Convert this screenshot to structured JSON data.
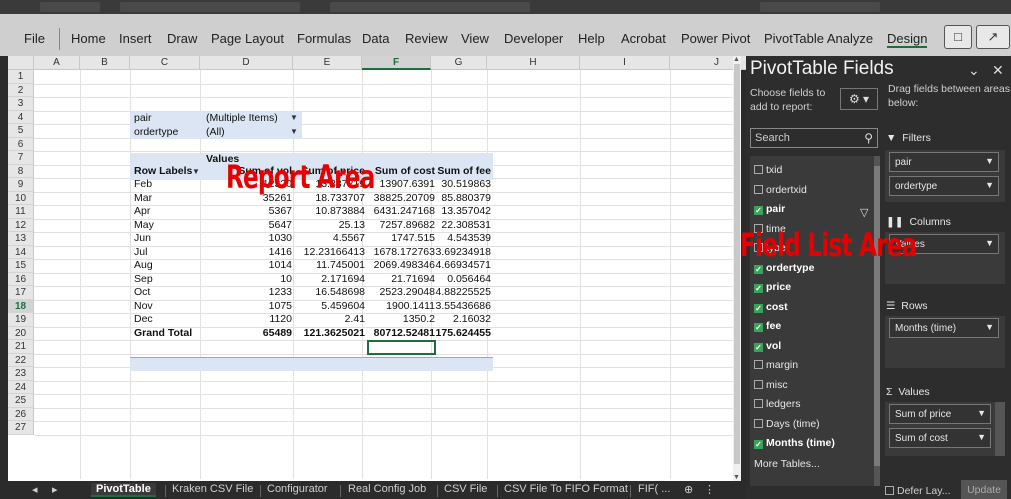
{
  "ribbon": {
    "tabs": [
      "File",
      "Home",
      "Insert",
      "Draw",
      "Page Layout",
      "Formulas",
      "Data",
      "Review",
      "View",
      "Developer",
      "Help",
      "Acrobat",
      "Power Pivot",
      "PivotTable Analyze",
      "Design"
    ],
    "comment_icon": "comment-icon",
    "share_icon": "share-icon"
  },
  "grid": {
    "columns": [
      "A",
      "B",
      "C",
      "D",
      "E",
      "F",
      "G",
      "H",
      "I",
      "J"
    ],
    "rows": [
      "1",
      "2",
      "3",
      "4",
      "5",
      "6",
      "7",
      "8",
      "9",
      "10",
      "11",
      "12",
      "13",
      "14",
      "15",
      "16",
      "17",
      "18",
      "19",
      "20",
      "21",
      "22",
      "23",
      "24",
      "25",
      "26",
      "27"
    ],
    "selected_column": "F",
    "selected_row": "18"
  },
  "pivot": {
    "filters": [
      {
        "label": "pair",
        "value": "(Multiple Items)"
      },
      {
        "label": "ordertype",
        "value": "(All)"
      }
    ],
    "values_caption": "Values",
    "headers": [
      "Row Labels",
      "Sum of vol",
      "Sum of price",
      "Sum of cost",
      "Sum of fee"
    ],
    "rows": [
      [
        "Feb",
        "12320",
        "13.887219",
        "13907.6391",
        "30.519863"
      ],
      [
        "Mar",
        "35261",
        "18.733707",
        "38825.20709",
        "85.880379"
      ],
      [
        "Apr",
        "5367",
        "10.873884",
        "6431.247168",
        "13.357042"
      ],
      [
        "May",
        "5647",
        "25.13",
        "7257.89682",
        "22.308531"
      ],
      [
        "Jun",
        "1030",
        "4.5567",
        "1747.515",
        "4.543539"
      ],
      [
        "Jul",
        "1416",
        "12.23166413",
        "1678.172763",
        "3.69234918"
      ],
      [
        "Aug",
        "1014",
        "11.745001",
        "2069.498346",
        "4.66934571"
      ],
      [
        "Sep",
        "10",
        "2.171694",
        "21.71694",
        "0.056464"
      ],
      [
        "Oct",
        "1233",
        "16.548698",
        "2523.29048",
        "4.88225525"
      ],
      [
        "Nov",
        "1075",
        "5.459604",
        "1900.1411",
        "3.55436686"
      ],
      [
        "Dec",
        "1120",
        "2.41",
        "1350.2",
        "2.16032"
      ]
    ],
    "total": [
      "Grand Total",
      "65489",
      "121.3625021",
      "80712.52481",
      "175.624455"
    ]
  },
  "overlays": {
    "report_area": "Report Area",
    "field_list_area": "Field List Area"
  },
  "sheet_tabs": [
    "PivotTable",
    "Kraken CSV File",
    "Configurator",
    "Real Config Job",
    "CSV File",
    "CSV File To FIFO Format",
    "FIF( ..."
  ],
  "field_pane": {
    "title": "PivotTable Fields",
    "choose_label": "Choose fields to add to report:",
    "drag_label": "Drag fields between areas below:",
    "search_placeholder": "Search",
    "fields": [
      {
        "name": "txid",
        "checked": false
      },
      {
        "name": "ordertxid",
        "checked": false
      },
      {
        "name": "pair",
        "checked": true
      },
      {
        "name": "time",
        "checked": false
      },
      {
        "name": "type",
        "checked": false
      },
      {
        "name": "ordertype",
        "checked": true
      },
      {
        "name": "price",
        "checked": true
      },
      {
        "name": "cost",
        "checked": true
      },
      {
        "name": "fee",
        "checked": true
      },
      {
        "name": "vol",
        "checked": true
      },
      {
        "name": "margin",
        "checked": false
      },
      {
        "name": "misc",
        "checked": false
      },
      {
        "name": "ledgers",
        "checked": false
      },
      {
        "name": "Days (time)",
        "checked": false
      },
      {
        "name": "Months (time)",
        "checked": true
      }
    ],
    "more_tables": "More Tables...",
    "areas": {
      "filters_label": "Filters",
      "filters": [
        "pair",
        "ordertype"
      ],
      "columns_label": "Columns",
      "columns": [
        "Values"
      ],
      "rows_label": "Rows",
      "rows": [
        "Months (time)"
      ],
      "values_label": "Values",
      "values": [
        "Sum of price",
        "Sum of cost"
      ]
    },
    "defer_label": "Defer Lay...",
    "update_label": "Update"
  }
}
